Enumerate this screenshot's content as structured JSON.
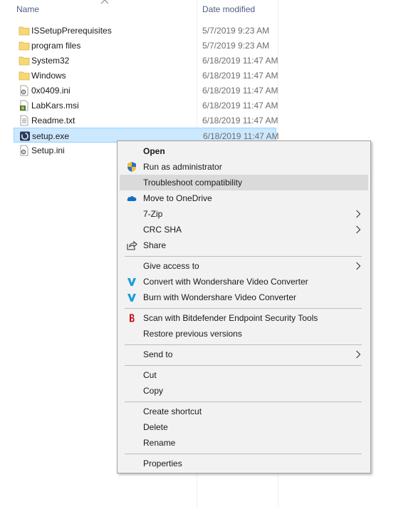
{
  "header": {
    "name_label": "Name",
    "date_label": "Date modified"
  },
  "files": [
    {
      "name": "ISSetupPrerequisites",
      "date": "5/7/2019 9:23 AM",
      "icon": "folder-icon"
    },
    {
      "name": "program files",
      "date": "5/7/2019 9:23 AM",
      "icon": "folder-icon"
    },
    {
      "name": "System32",
      "date": "6/18/2019 11:47 AM",
      "icon": "folder-icon"
    },
    {
      "name": "Windows",
      "date": "6/18/2019 11:47 AM",
      "icon": "folder-icon"
    },
    {
      "name": "0x0409.ini",
      "date": "6/18/2019 11:47 AM",
      "icon": "settings-file-icon"
    },
    {
      "name": "LabKars.msi",
      "date": "6/18/2019 11:47 AM",
      "icon": "installer-package-icon"
    },
    {
      "name": "Readme.txt",
      "date": "6/18/2019 11:47 AM",
      "icon": "text-file-icon"
    },
    {
      "name": "setup.exe",
      "date": "6/18/2019 11:47 AM",
      "icon": "setup-exe-icon",
      "selected": true
    },
    {
      "name": "Setup.ini",
      "date": "",
      "icon": "settings-file-icon"
    }
  ],
  "context_menu": {
    "open": "Open",
    "run_as_admin": "Run as administrator",
    "troubleshoot": "Troubleshoot compatibility",
    "move_onedrive": "Move to OneDrive",
    "seven_zip": "7-Zip",
    "crc_sha": "CRC SHA",
    "share": "Share",
    "give_access": "Give access to",
    "convert_wondershare": "Convert with Wondershare Video Converter",
    "burn_wondershare": "Burn with Wondershare Video Converter",
    "scan_bitdefender": "Scan with Bitdefender Endpoint Security Tools",
    "restore_versions": "Restore previous versions",
    "send_to": "Send to",
    "cut": "Cut",
    "copy": "Copy",
    "create_shortcut": "Create shortcut",
    "delete": "Delete",
    "rename": "Rename",
    "properties": "Properties"
  },
  "colors": {
    "selection_bg": "#cce8ff",
    "menu_bg": "#f2f2f2",
    "menu_hover": "#dadada",
    "folder": "#f8d775",
    "onedrive": "#0f6fc6",
    "wondershare": "#1a9bd7",
    "bitdefender": "#d0021b"
  }
}
